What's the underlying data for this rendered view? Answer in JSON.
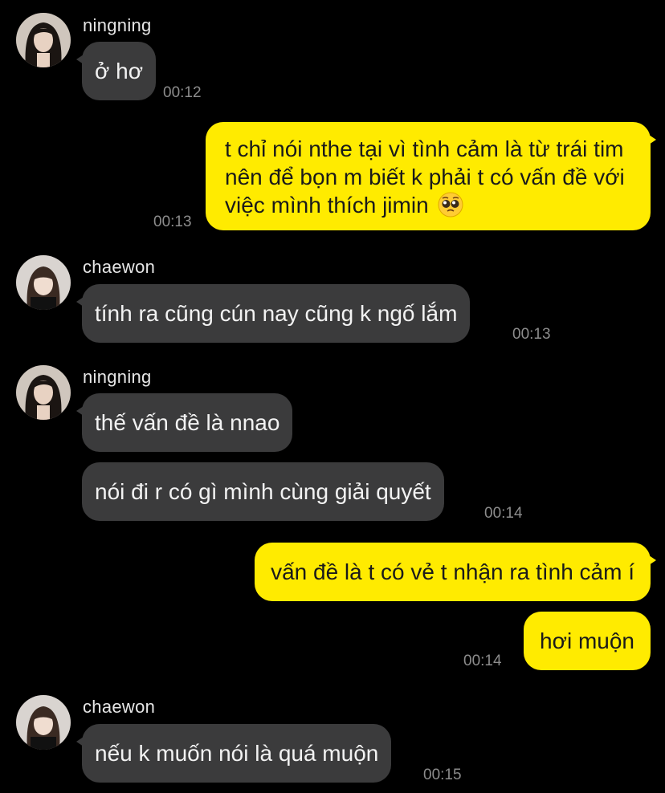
{
  "messages": [
    {
      "sender": "ningning",
      "text": "ở hơ",
      "time": "00:12"
    },
    {
      "text": "t chỉ nói nthe tại vì tình cảm là từ trái tim nên để bọn m biết k phải t có vấn đề với việc mình thích jimin",
      "emoji": "pleading-face-emoji",
      "time": "00:13"
    },
    {
      "sender": "chaewon",
      "text": "tính ra cũng cún nay cũng k ngố lắm",
      "time": "00:13"
    },
    {
      "sender": "ningning",
      "text": "thế vấn đề là nnao"
    },
    {
      "text": "nói đi r có gì mình cùng giải quyết",
      "time": "00:14"
    },
    {
      "text": "vấn đề là t có vẻ t nhận ra tình cảm í"
    },
    {
      "text": "hơi muộn",
      "time": "00:14"
    },
    {
      "sender": "chaewon",
      "text": "nếu k muốn nói là quá muộn",
      "time": "00:15"
    }
  ],
  "colors": {
    "background": "#000000",
    "incoming_bubble": "#3b3b3c",
    "outgoing_bubble": "#ffeb00",
    "timestamp": "#8c8c8c"
  }
}
